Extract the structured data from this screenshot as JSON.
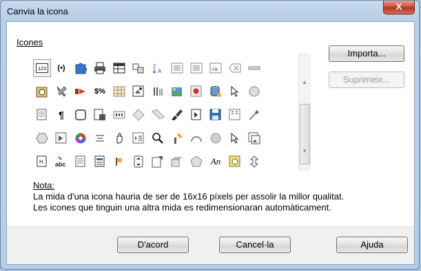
{
  "window": {
    "title": "Canvia la icona",
    "close_label": "X"
  },
  "icons_section": {
    "label": "Icones"
  },
  "buttons": {
    "import_label": "Importa...",
    "delete_label": "Suprimeix...",
    "ok_label": "D'acord",
    "cancel_label": "Cancel·la",
    "help_label": "Ajuda"
  },
  "note": {
    "heading": "Nota:",
    "line1": "La mida d'una icona hauria de ser de 16x16 píxels per assolir la millor qualitat.",
    "line2": "Les icones que tinguin una altra mida es redimensionaran automàticament."
  },
  "icon_glyphs": {
    "numbers": "123",
    "braces": "(•)",
    "text_An": "An",
    "abc": "abc",
    "dollar_percent": "$%",
    "pilcrow": "¶",
    "sqrt_a": "√a"
  },
  "colors": {
    "window_blue": "#b9cfe8",
    "close_red": "#c74a35",
    "footer_gray": "#f0f0f0"
  }
}
